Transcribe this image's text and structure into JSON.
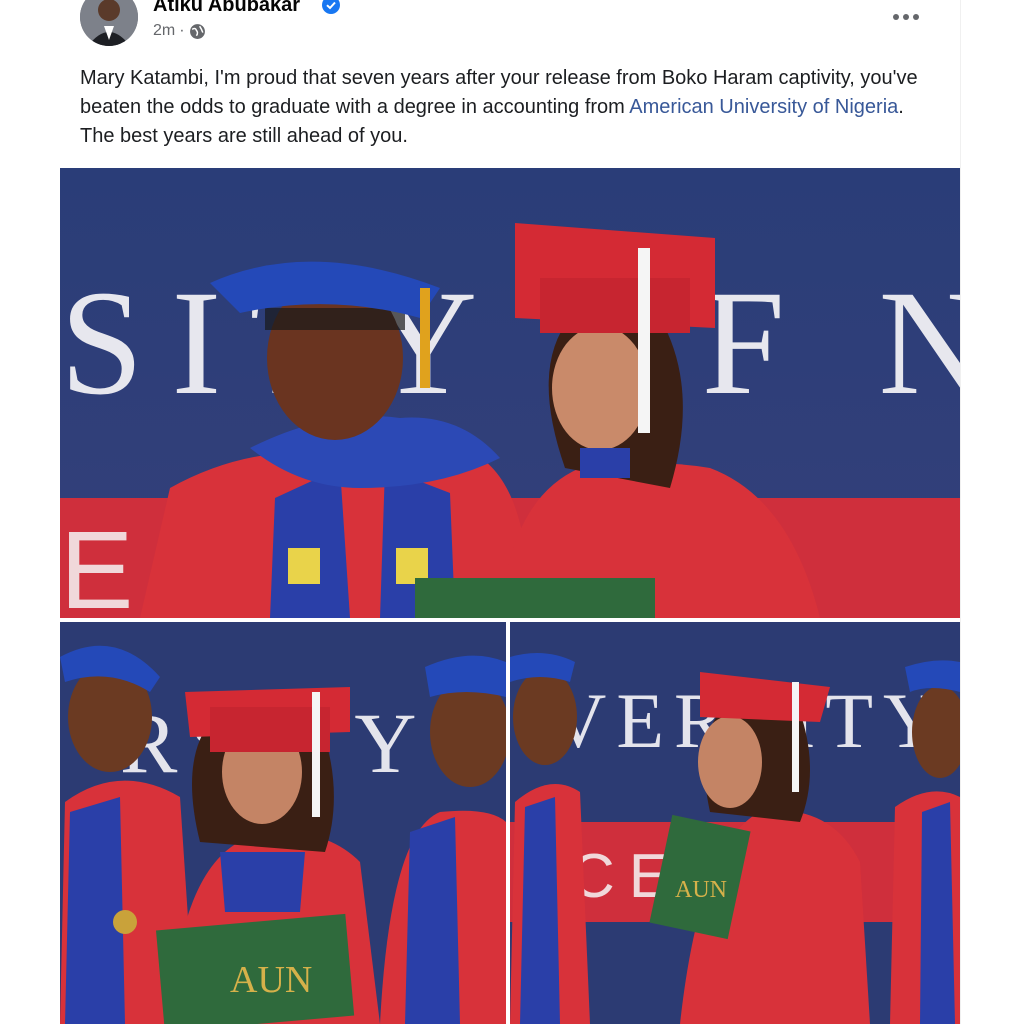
{
  "post": {
    "author": "Atiku Abubakar",
    "verified_icon": "verified-badge-icon",
    "time": "2m",
    "separator": "·",
    "audience_icon": "globe-icon",
    "more_icon": "more-options-icon",
    "text_part1": "Mary Katambi, I'm proud that seven years after your release from Boko Haram captivity, you've beaten the odds to graduate with a degree in accounting from ",
    "link_text": "American University of Nigeria",
    "text_part2": ". The best years are still ahead of you."
  },
  "photos": {
    "top": {
      "backdrop_text": "SITY OF N",
      "banner_text": "E     M"
    },
    "bottom_left": {
      "backdrop_text": "RSITY",
      "diploma_text": "AUN"
    },
    "bottom_right": {
      "backdrop_text": "VERSITY",
      "banner_text": "CE",
      "diploma_text": "AUN"
    }
  },
  "colors": {
    "accent_link": "#385898",
    "verified_blue": "#1877f2",
    "gown_red": "#d8323a",
    "backdrop_navy": "#2b3a70",
    "velvet_blue": "#2a3fa8"
  }
}
